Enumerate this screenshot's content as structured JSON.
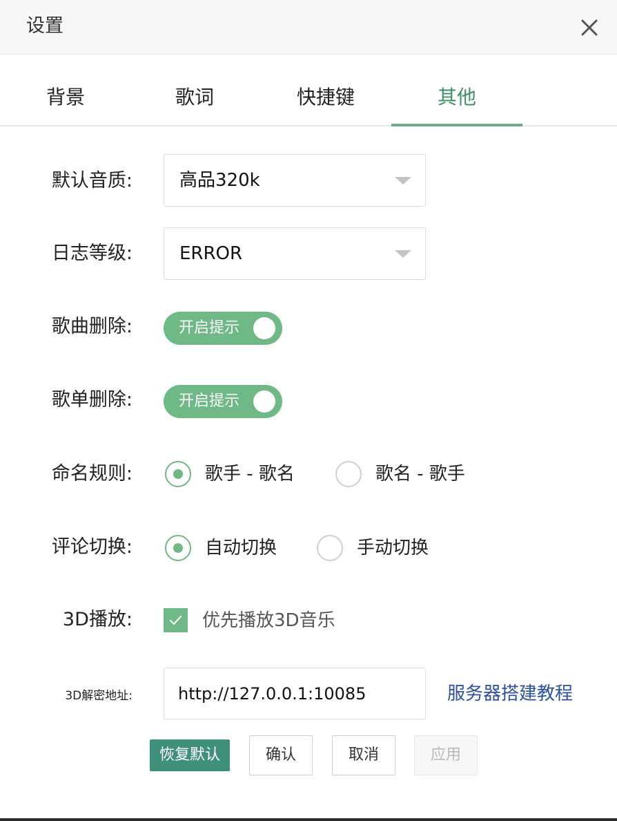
{
  "window": {
    "title": "设置",
    "close_icon": "close-icon"
  },
  "tabs": [
    {
      "label": "背景",
      "active": false
    },
    {
      "label": "歌词",
      "active": false
    },
    {
      "label": "快捷键",
      "active": false
    },
    {
      "label": "其他",
      "active": true
    }
  ],
  "settings": {
    "quality": {
      "label": "默认音质:",
      "value": "高品320k"
    },
    "log_level": {
      "label": "日志等级:",
      "value": "ERROR"
    },
    "song_delete": {
      "label": "歌曲删除:",
      "switch_text": "开启提示",
      "on": true
    },
    "playlist_delete": {
      "label": "歌单删除:",
      "switch_text": "开启提示",
      "on": true
    },
    "naming_rule": {
      "label": "命名规则:",
      "options": [
        {
          "label": "歌手 - 歌名",
          "checked": true
        },
        {
          "label": "歌名 - 歌手",
          "checked": false
        }
      ]
    },
    "comment_switch": {
      "label": "评论切换:",
      "options": [
        {
          "label": "自动切换",
          "checked": true
        },
        {
          "label": "手动切换",
          "checked": false
        }
      ]
    },
    "play_3d": {
      "label": "3D播放:",
      "checkbox_label": "优先播放3D音乐",
      "checked": true
    },
    "decrypt_address": {
      "label": "3D解密地址:",
      "value": "http://127.0.0.1:10085",
      "link": "服务器搭建教程"
    }
  },
  "buttons": {
    "restore": "恢复默认",
    "confirm": "确认",
    "cancel": "取消",
    "apply": "应用"
  },
  "colors": {
    "accent": "#6eb985",
    "active_tab": "#3d9068",
    "restore_button": "#3f907a",
    "link": "#2d4fa6"
  }
}
